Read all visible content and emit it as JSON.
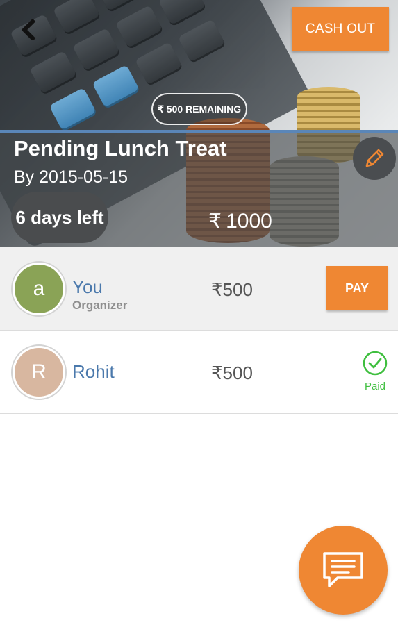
{
  "header": {
    "cash_out_label": "CASH OUT",
    "remaining_currency": "₹",
    "remaining_text": "500 REMAINING",
    "title": "Pending Lunch Treat",
    "date": "By 2015-05-15",
    "days_left": "6 days left",
    "total_currency": "₹",
    "total_amount": "1000",
    "back_icon": "chevron-left-icon",
    "edit_icon": "pencil-icon"
  },
  "participants": [
    {
      "avatar_letter": "a",
      "avatar_color": "#8aa356",
      "name": "You",
      "role": "Organizer",
      "amount": "₹500",
      "action_label": "PAY"
    },
    {
      "avatar_letter": "R",
      "avatar_color": "#d8b7a0",
      "name": "Rohit",
      "amount": "₹500",
      "status_label": "Paid",
      "status_icon": "check-circle-icon"
    }
  ],
  "fab": {
    "icon": "chat-icon"
  },
  "colors": {
    "accent": "#ef8733",
    "link": "#4b79ac",
    "paid": "#3fbf3f"
  }
}
